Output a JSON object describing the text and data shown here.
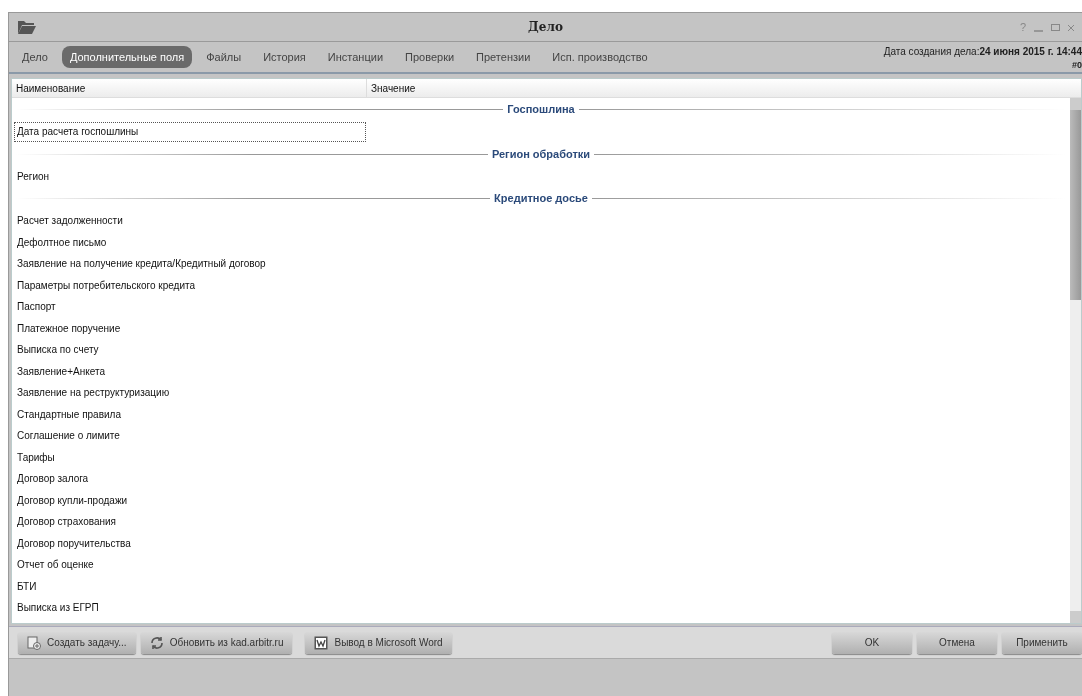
{
  "window": {
    "title": "Дело",
    "help": "?"
  },
  "tabs": [
    {
      "label": "Дело",
      "selected": false
    },
    {
      "label": "Дополнительные поля",
      "selected": true
    },
    {
      "label": "Файлы",
      "selected": false
    },
    {
      "label": "История",
      "selected": false
    },
    {
      "label": "Инстанции",
      "selected": false
    },
    {
      "label": "Проверки",
      "selected": false
    },
    {
      "label": "Претензии",
      "selected": false
    },
    {
      "label": "Исп. производство",
      "selected": false
    }
  ],
  "created": {
    "label": "Дата создания дела:",
    "value": "24 июня 2015 г. 14:44",
    "number": "#0"
  },
  "table": {
    "columns": [
      "Наименование",
      "Значение"
    ],
    "sections": [
      {
        "title": "Госпошлина",
        "rows": [
          {
            "name": "Дата расчета госпошлины",
            "focused": true
          }
        ]
      },
      {
        "title": "Регион обработки",
        "rows": [
          {
            "name": "Регион",
            "focused": false
          }
        ]
      },
      {
        "title": "Кредитное досье",
        "rows": [
          {
            "name": "Расчет задолженности",
            "focused": false
          },
          {
            "name": "Дефолтное письмо",
            "focused": false
          },
          {
            "name": "Заявление на получение кредита/Кредитный договор",
            "focused": false
          },
          {
            "name": "Параметры потребительского кредита",
            "focused": false
          },
          {
            "name": "Паспорт",
            "focused": false
          },
          {
            "name": "Платежное поручение",
            "focused": false
          },
          {
            "name": "Выписка по счету",
            "focused": false
          },
          {
            "name": "Заявление+Анкета",
            "focused": false
          },
          {
            "name": "Заявление на реструктуризацию",
            "focused": false
          },
          {
            "name": "Стандартные правила",
            "focused": false
          },
          {
            "name": "Соглашение о лимите",
            "focused": false
          },
          {
            "name": "Тарифы",
            "focused": false
          },
          {
            "name": "Договор залога",
            "focused": false
          },
          {
            "name": "Договор купли-продажи",
            "focused": false
          },
          {
            "name": "Договор страхования",
            "focused": false
          },
          {
            "name": "Договор поручительства",
            "focused": false
          },
          {
            "name": "Отчет об оценке",
            "focused": false
          },
          {
            "name": "БТИ",
            "focused": false
          },
          {
            "name": "Выписка из ЕГРП",
            "focused": false
          }
        ]
      }
    ]
  },
  "left_buttons": [
    {
      "label": "Создать задачу...",
      "kind": "task"
    },
    {
      "label": "Обновить из kad.arbitr.ru",
      "kind": "refresh"
    },
    {
      "label": "Вывод в Microsoft Word",
      "kind": "word"
    }
  ],
  "right_buttons": [
    "OK",
    "Отмена",
    "Применить"
  ]
}
